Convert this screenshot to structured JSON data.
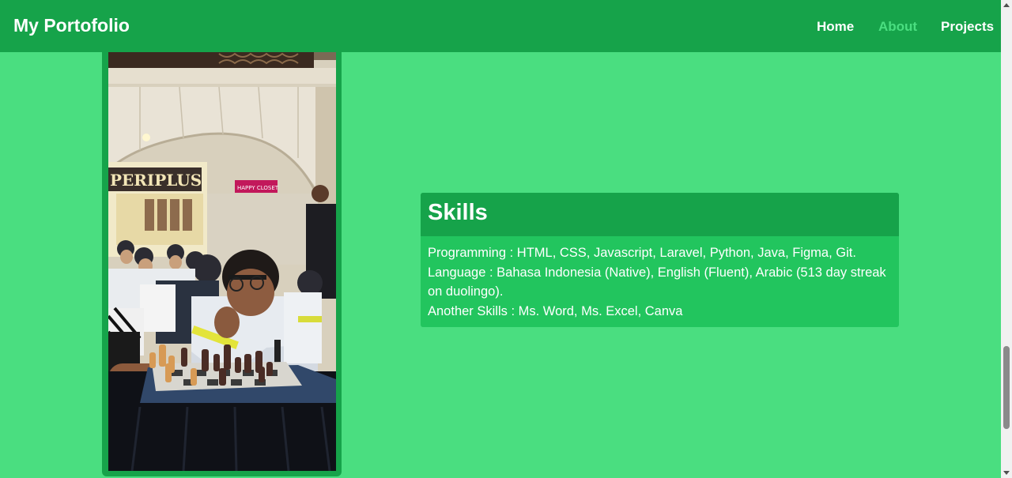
{
  "navbar": {
    "brand": "My Portofolio",
    "links": [
      {
        "label": "Home",
        "active": false
      },
      {
        "label": "About",
        "active": true
      },
      {
        "label": "Projects",
        "active": false
      }
    ]
  },
  "photo": {
    "store_sign": "PERIPLUS",
    "shop_sign": "HAPPY CLOSET"
  },
  "skills": {
    "title": "Skills",
    "lines": [
      "Programming : HTML, CSS, Javascript, Laravel, Python, Java, Figma, Git.",
      "Language : Bahasa Indonesia (Native), English (Fluent), Arabic (513 day streak on duolingo).",
      "Another Skills : Ms. Word, Ms. Excel, Canva"
    ]
  },
  "colors": {
    "page_bg": "#4ade80",
    "navbar_bg": "#16a34a",
    "card_bg": "#22c55e",
    "active_link": "#4ade80"
  }
}
